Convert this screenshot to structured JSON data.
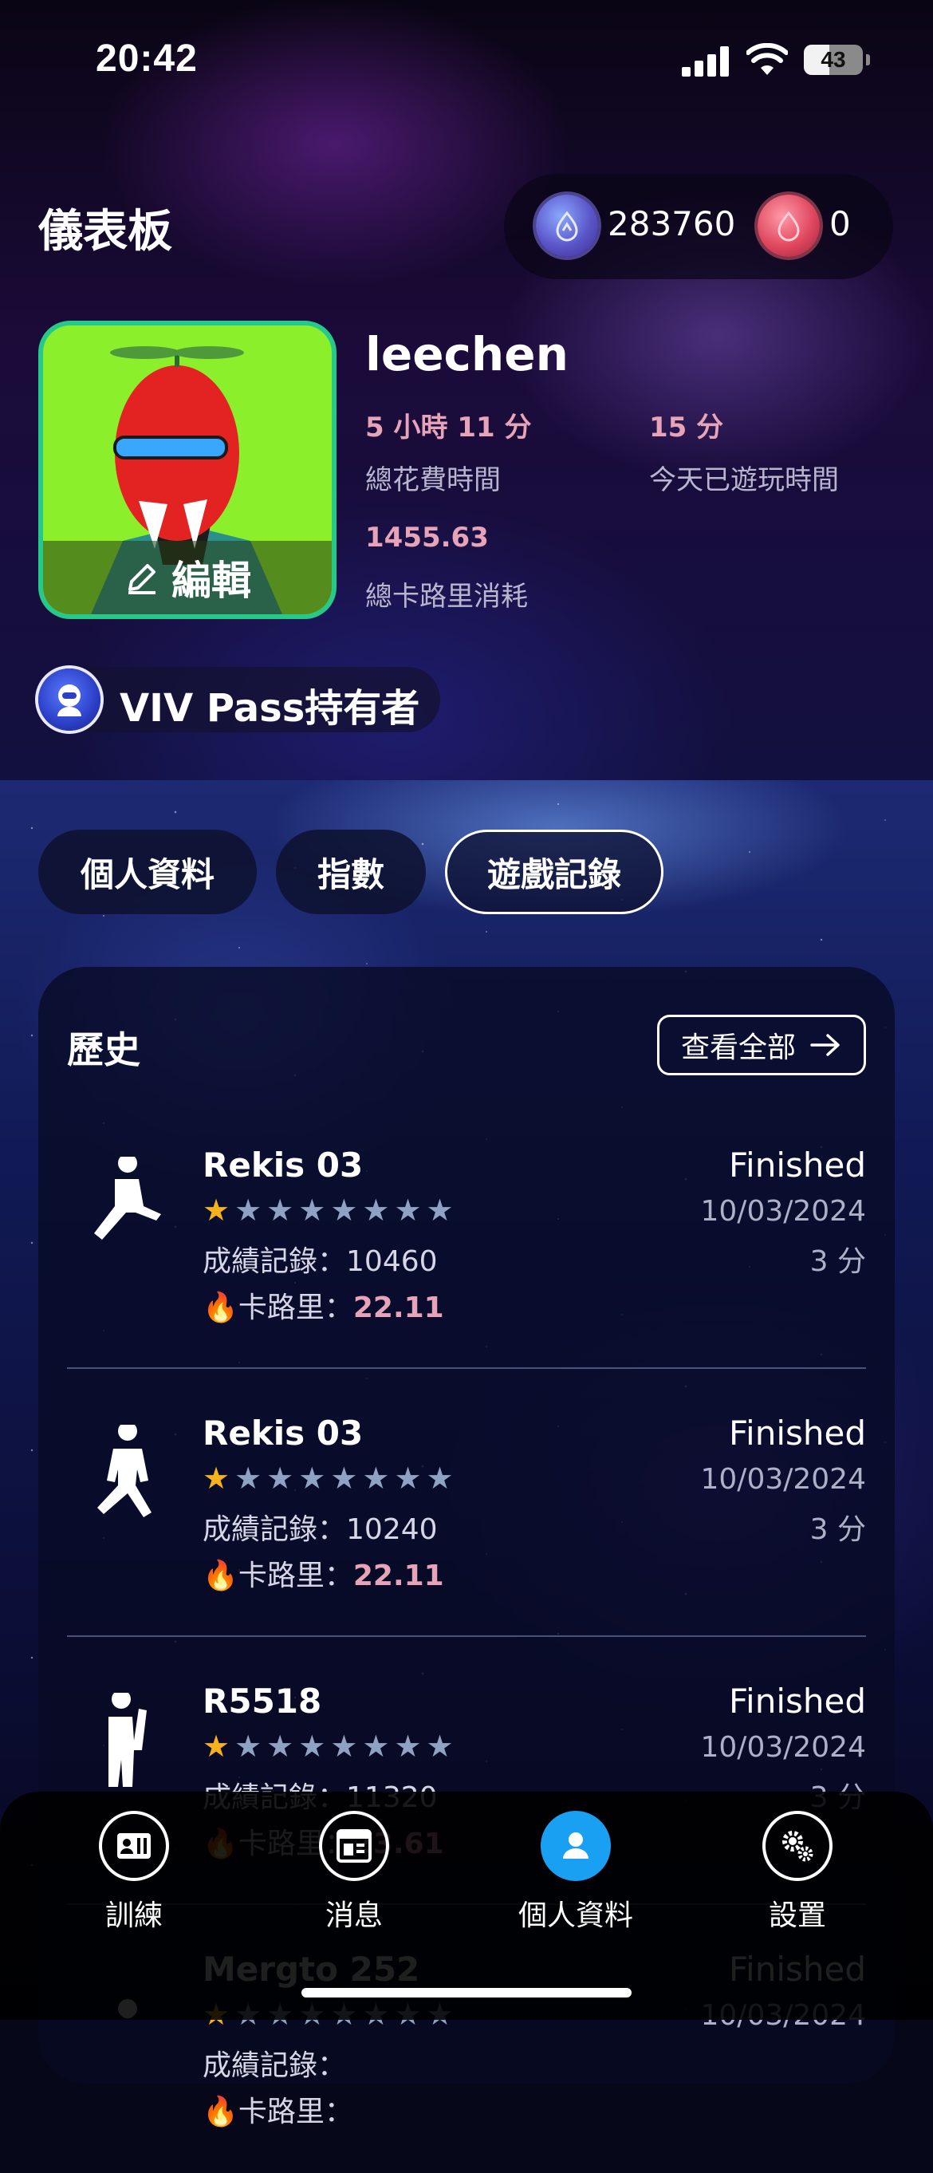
{
  "status_bar": {
    "time": "20:42",
    "battery": "43",
    "battery_level": 0.43
  },
  "header": {
    "title": "儀表板",
    "currency_a": "283760",
    "currency_b": "0"
  },
  "profile": {
    "username": "leechen",
    "edit_label": "編輯",
    "total_time_value": "5 小時 11 分",
    "total_time_label": "總花費時間",
    "today_value": "15 分",
    "today_label": "今天已遊玩時間",
    "calories_value": "1455.63",
    "calories_label": "總卡路里消耗",
    "pass_label": "VIV Pass持有者"
  },
  "tabs": [
    {
      "label": "個人資料",
      "active": false
    },
    {
      "label": "指數",
      "active": false
    },
    {
      "label": "遊戲記錄",
      "active": true
    }
  ],
  "history": {
    "title": "歷史",
    "view_all": "查看全部",
    "score_prefix": "成績記錄：",
    "calorie_prefix": "卡路里：",
    "items": [
      {
        "game": "Rekis 03",
        "rating": 1,
        "max_rating": 8,
        "score": "10460",
        "calories": "22.11",
        "status": "Finished",
        "date": "10/03/2024",
        "duration": "3 分"
      },
      {
        "game": "Rekis 03",
        "rating": 1,
        "max_rating": 8,
        "score": "10240",
        "calories": "22.11",
        "status": "Finished",
        "date": "10/03/2024",
        "duration": "3 分"
      },
      {
        "game": "R5518",
        "rating": 1,
        "max_rating": 8,
        "score": "11320",
        "calories": "23.61",
        "status": "Finished",
        "date": "10/03/2024",
        "duration": "3 分"
      },
      {
        "game": "Mergto 252",
        "rating": 1,
        "max_rating": 8,
        "score": "",
        "calories": "",
        "status": "Finished",
        "date": "10/03/2024",
        "duration": ""
      }
    ]
  },
  "bottom_nav": [
    {
      "label": "訓練",
      "icon": "id-card-icon",
      "active": false
    },
    {
      "label": "消息",
      "icon": "news-icon",
      "active": false
    },
    {
      "label": "個人資料",
      "icon": "person-icon",
      "active": true
    },
    {
      "label": "設置",
      "icon": "gears-icon",
      "active": false
    }
  ],
  "colors": {
    "accent_pink": "#e7a3b8",
    "nav_active": "#1aa0f3",
    "avatar_border": "#26c98a",
    "star_gold": "#f5b21b",
    "star_grey": "#8ea3c3"
  }
}
